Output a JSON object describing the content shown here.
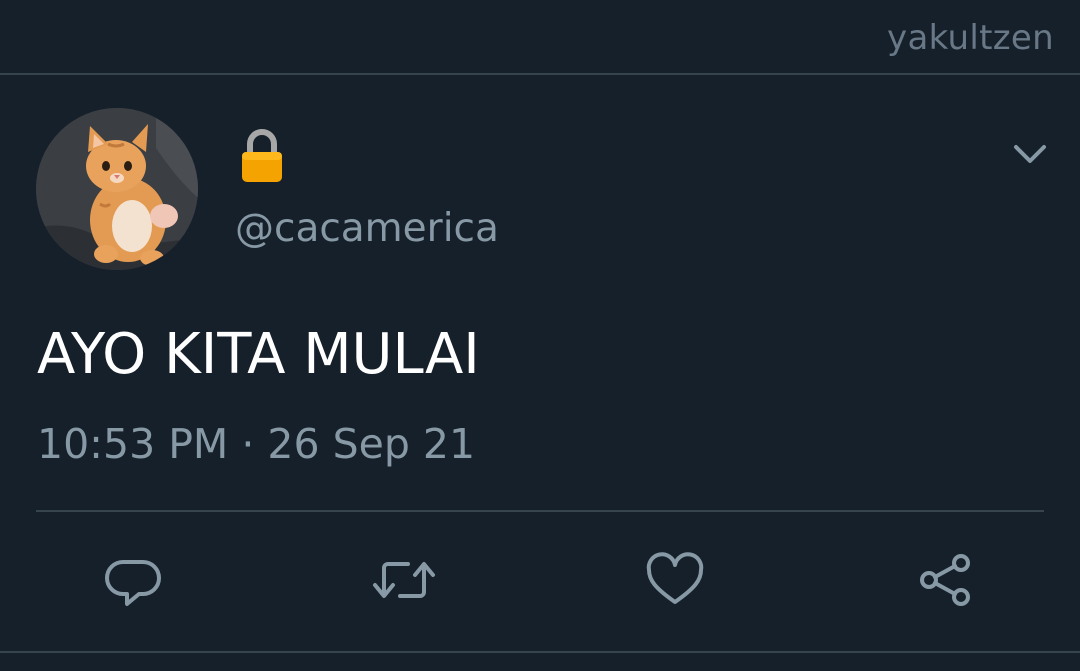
{
  "watermark": "yakultzen",
  "tweet": {
    "account_status_icon": "lock-icon",
    "handle": "@cacamerica",
    "text": "AYO KITA MULAI",
    "timestamp": "10:53 PM · 26 Sep 21"
  },
  "actions": [
    {
      "name": "reply",
      "icon": "reply-icon"
    },
    {
      "name": "retweet",
      "icon": "retweet-icon"
    },
    {
      "name": "like",
      "icon": "heart-icon"
    },
    {
      "name": "share",
      "icon": "share-icon"
    }
  ],
  "colors": {
    "background": "#16202b",
    "divider": "#38444d",
    "secondary_text": "#8899a6",
    "primary_text": "#ffffff",
    "lock": "#f4a300"
  }
}
